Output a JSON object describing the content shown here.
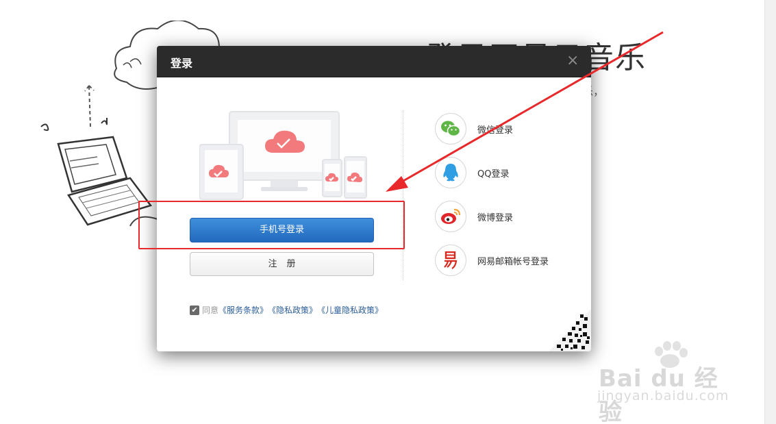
{
  "background": {
    "heading": "登录网易云音乐",
    "subtext": "乐，"
  },
  "dialog": {
    "title": "登录",
    "close_symbol": "×",
    "phone_login_label": "手机号登录",
    "register_label": "注册",
    "agree": {
      "checked_symbol": "✔",
      "prefix": "同意",
      "terms": "《服务条款》",
      "privacy": "《隐私政策》",
      "child_privacy": "《儿童隐私政策》"
    },
    "social": [
      {
        "label": "微信登录",
        "icon": "wechat-icon",
        "color": "#60b547"
      },
      {
        "label": "QQ登录",
        "icon": "qq-icon",
        "color": "#2f9ee3"
      },
      {
        "label": "微博登录",
        "icon": "weibo-icon",
        "color": "#e0262b"
      },
      {
        "label": "网易邮箱帐号登录",
        "icon": "netease-mail-icon",
        "color": "#d9281e"
      }
    ]
  },
  "watermark": {
    "logo": "Bai du 经验",
    "url": "jingyan.baidu.com"
  },
  "colors": {
    "header_bg": "#2b2b2b",
    "primary_button": "#2a74c9",
    "annotation_red": "#e8282a"
  }
}
